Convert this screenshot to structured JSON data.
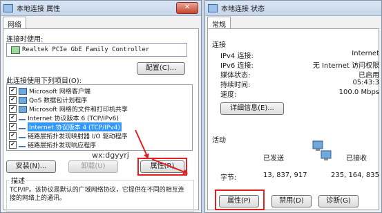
{
  "left_window": {
    "title": "本地连接 属性",
    "close": "✕",
    "tab": "网络",
    "connect_using_label": "连接时使用:",
    "adapter_name": "Realtek PCIe GbE Family Controller",
    "configure_button": "配置(C)...",
    "items_label": "此连接使用下列项目(O):",
    "items": [
      {
        "label": "Microsoft 网络客户端",
        "checked": "✔"
      },
      {
        "label": "QoS 数据包计划程序",
        "checked": "✔"
      },
      {
        "label": "Microsoft 网络的文件和打印机共享",
        "checked": "✔"
      },
      {
        "label": "Internet 协议版本 6 (TCP/IPv6)",
        "checked": "✔"
      },
      {
        "label": "Internet 协议版本 4 (TCP/IPv4)",
        "checked": "✔"
      },
      {
        "label": "链路层拓扑发现映射器 I/O 驱动程序",
        "checked": "✔"
      },
      {
        "label": "链路层拓扑发现响应程序",
        "checked": "✔"
      }
    ],
    "install_button": "安装(N)...",
    "uninstall_button": "卸载(U)",
    "properties_button": "属性(R)",
    "watermark": "wx:dgyyrj",
    "description_label": "描述",
    "description_text": "TCP/IP。该协议是默认的广域网络协议，它提供在不同的相互连接的网络上的通讯。"
  },
  "right_window": {
    "title": "本地连接 状态",
    "tab": "常规",
    "connection_label": "连接",
    "rows": [
      {
        "label": "IPv4 连接:",
        "value": "Internet"
      },
      {
        "label": "IPv6 连接:",
        "value": "无 Internet 访问权限"
      },
      {
        "label": "媒体状态:",
        "value": "已启用"
      },
      {
        "label": "持续时间:",
        "value": "05:43:3"
      },
      {
        "label": "速度:",
        "value": "100.0 Mbps"
      }
    ],
    "details_button": "详细信息(E)...",
    "activity_label": "活动",
    "sent_label": "已发送",
    "received_label": "已接收",
    "bytes_label": "字节:",
    "bytes_sent": "13, 837, 917",
    "bytes_received": "235, 164, 835",
    "properties_button": "属性(P)",
    "disable_button": "禁用(D)",
    "diagnose_button": "诊断(G)"
  },
  "colors": {
    "highlight": "#3399ff",
    "annotation_red": "#e02020"
  }
}
